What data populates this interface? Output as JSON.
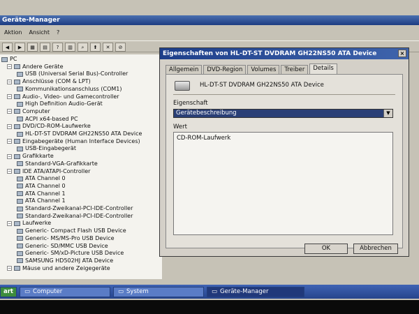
{
  "main_window": {
    "title": "Geräte-Manager",
    "menu": [
      "Aktion",
      "Ansicht",
      "?"
    ]
  },
  "tree": [
    {
      "label": "PC",
      "level": 0
    },
    {
      "label": "Andere Geräte",
      "level": 1
    },
    {
      "label": "USB (Universal Serial Bus)-Controller",
      "level": 2
    },
    {
      "label": "Anschlüsse (COM & LPT)",
      "level": 1
    },
    {
      "label": "Kommunikationsanschluss (COM1)",
      "level": 2
    },
    {
      "label": "Audio-, Video- und Gamecontroller",
      "level": 1
    },
    {
      "label": "High Definition Audio-Gerät",
      "level": 2
    },
    {
      "label": "Computer",
      "level": 1
    },
    {
      "label": "ACPI x64-based PC",
      "level": 2
    },
    {
      "label": "DVD/CD-ROM-Laufwerke",
      "level": 1
    },
    {
      "label": "HL-DT-ST DVDRAM GH22NS50 ATA Device",
      "level": 2
    },
    {
      "label": "Eingabegeräte (Human Interface Devices)",
      "level": 1
    },
    {
      "label": "USB-Eingabegerät",
      "level": 2
    },
    {
      "label": "Grafikkarte",
      "level": 1
    },
    {
      "label": "Standard-VGA-Grafikkarte",
      "level": 2
    },
    {
      "label": "IDE ATA/ATAPI-Controller",
      "level": 1
    },
    {
      "label": "ATA Channel 0",
      "level": 2
    },
    {
      "label": "ATA Channel 0",
      "level": 2
    },
    {
      "label": "ATA Channel 1",
      "level": 2
    },
    {
      "label": "ATA Channel 1",
      "level": 2
    },
    {
      "label": "Standard-Zweikanal-PCI-IDE-Controller",
      "level": 2
    },
    {
      "label": "Standard-Zweikanal-PCI-IDE-Controller",
      "level": 2
    },
    {
      "label": "Laufwerke",
      "level": 1
    },
    {
      "label": "Generic- Compact Flash USB Device",
      "level": 2
    },
    {
      "label": "Generic- MS/MS-Pro USB Device",
      "level": 2
    },
    {
      "label": "Generic- SD/MMC USB Device",
      "level": 2
    },
    {
      "label": "Generic- SM/xD-Picture USB Device",
      "level": 2
    },
    {
      "label": "SAMSUNG HD502HJ ATA Device",
      "level": 2
    },
    {
      "label": "Mäuse und andere Zeigegeräte",
      "level": 1
    }
  ],
  "dialog": {
    "title": "Eigenschaften von HL-DT-ST DVDRAM GH22NS50 ATA Device",
    "close": "×",
    "tabs": [
      "Allgemein",
      "DVD-Region",
      "Volumes",
      "Treiber",
      "Details"
    ],
    "active_tab": "Details",
    "device_name": "HL-DT-ST DVDRAM GH22NS50 ATA Device",
    "property_label": "Eigenschaft",
    "property_value": "Gerätebeschreibung",
    "value_label": "Wert",
    "values": [
      "CD-ROM-Laufwerk"
    ],
    "ok_label": "OK",
    "cancel_label": "Abbrechen"
  },
  "taskbar": {
    "start": "art",
    "items": [
      "Computer",
      "System",
      "Geräte-Manager"
    ],
    "active": "Geräte-Manager"
  }
}
